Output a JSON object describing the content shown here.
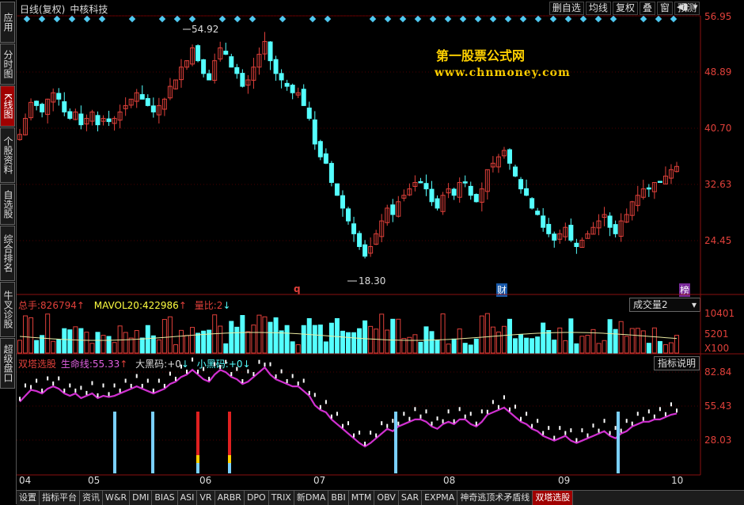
{
  "sidebar": [
    {
      "label": "应用",
      "active": false
    },
    {
      "label": "分时图",
      "active": false
    },
    {
      "label": "K线图",
      "active": true
    },
    {
      "label": "个股资料",
      "active": false
    },
    {
      "label": "自选股",
      "active": false
    },
    {
      "label": "综合排名",
      "active": false
    },
    {
      "label": "牛叉诊股",
      "active": false
    },
    {
      "label": "超级盘口",
      "active": false
    }
  ],
  "header": {
    "period": "日线(复权)",
    "stock": "中核科技"
  },
  "toolbar": [
    "删自选",
    "均线",
    "复权",
    "叠",
    "窗",
    "预测"
  ],
  "price_axis": [
    "56.95",
    "48.89",
    "40.70",
    "32.63",
    "24.45"
  ],
  "annotations": {
    "high": "54.92",
    "low": "18.30",
    "marker_q": "q",
    "marker_cai": "财",
    "marker_bang": "榜"
  },
  "watermark": {
    "line1": "第一股票公式网",
    "line2": "www.chnmoney.com"
  },
  "volume_panel": {
    "total_label": "总手:",
    "total_value": "826794",
    "mavol_label": "MAVOL20:",
    "mavol_value": "422986",
    "ratio_label": "量比:",
    "ratio_value": "2",
    "selector": "成交量2",
    "axis": [
      "10401",
      "5201",
      "X100"
    ]
  },
  "indicator_panel": {
    "name": "双塔选股",
    "life_label": "生命线:",
    "life_value": "55.33",
    "big_label": "大黑码:",
    "big_value": "+0",
    "small_label": "小黑码:",
    "small_value": "+0",
    "help": "指标说明",
    "axis": [
      "82.84",
      "55.43",
      "28.03"
    ]
  },
  "x_axis": [
    "04",
    "05",
    "06",
    "07",
    "08",
    "09",
    "10"
  ],
  "bottom_tabs": [
    "设置",
    "指标平台",
    "资讯",
    "W&R",
    "DMI",
    "BIAS",
    "ASI",
    "VR",
    "ARBR",
    "DPO",
    "TRIX",
    "新DMA",
    "BBI",
    "MTM",
    "OBV",
    "SAR",
    "EXPMA",
    "神奇逃顶术矛盾线",
    "双塔选股"
  ],
  "active_tab": "双塔选股",
  "colors": {
    "up": "#e0403a",
    "down": "#54ffff",
    "life_line": "#d030d0",
    "bg": "#000000"
  },
  "chart_data": {
    "type": "candlestick",
    "price_high": 54.92,
    "price_low": 18.3,
    "closes": [
      38.5,
      41,
      43.5,
      43,
      42,
      44,
      45,
      44,
      42,
      41,
      42,
      40,
      41,
      42,
      40,
      41,
      40.5,
      41,
      42,
      43,
      44,
      45,
      44,
      43,
      42,
      43,
      44,
      46,
      47,
      49,
      50,
      52,
      50,
      48,
      47,
      50,
      52,
      51,
      49,
      48,
      46,
      47,
      49,
      51,
      53,
      50,
      48,
      47,
      46,
      45,
      45,
      43,
      41,
      37,
      35,
      34,
      31,
      29,
      27,
      25,
      23,
      21,
      19.5,
      21,
      23,
      25,
      27,
      26,
      28,
      29,
      30,
      31,
      31,
      30,
      28,
      27,
      29,
      30,
      29,
      31,
      31,
      29,
      28,
      30,
      33,
      34,
      35,
      36,
      34,
      32,
      30,
      29,
      27,
      26,
      24,
      23,
      22,
      23,
      24,
      22,
      21,
      22,
      23,
      24,
      25,
      26,
      24,
      23,
      25,
      26,
      28,
      29,
      30,
      30,
      31,
      31,
      32,
      33,
      33.5
    ]
  }
}
